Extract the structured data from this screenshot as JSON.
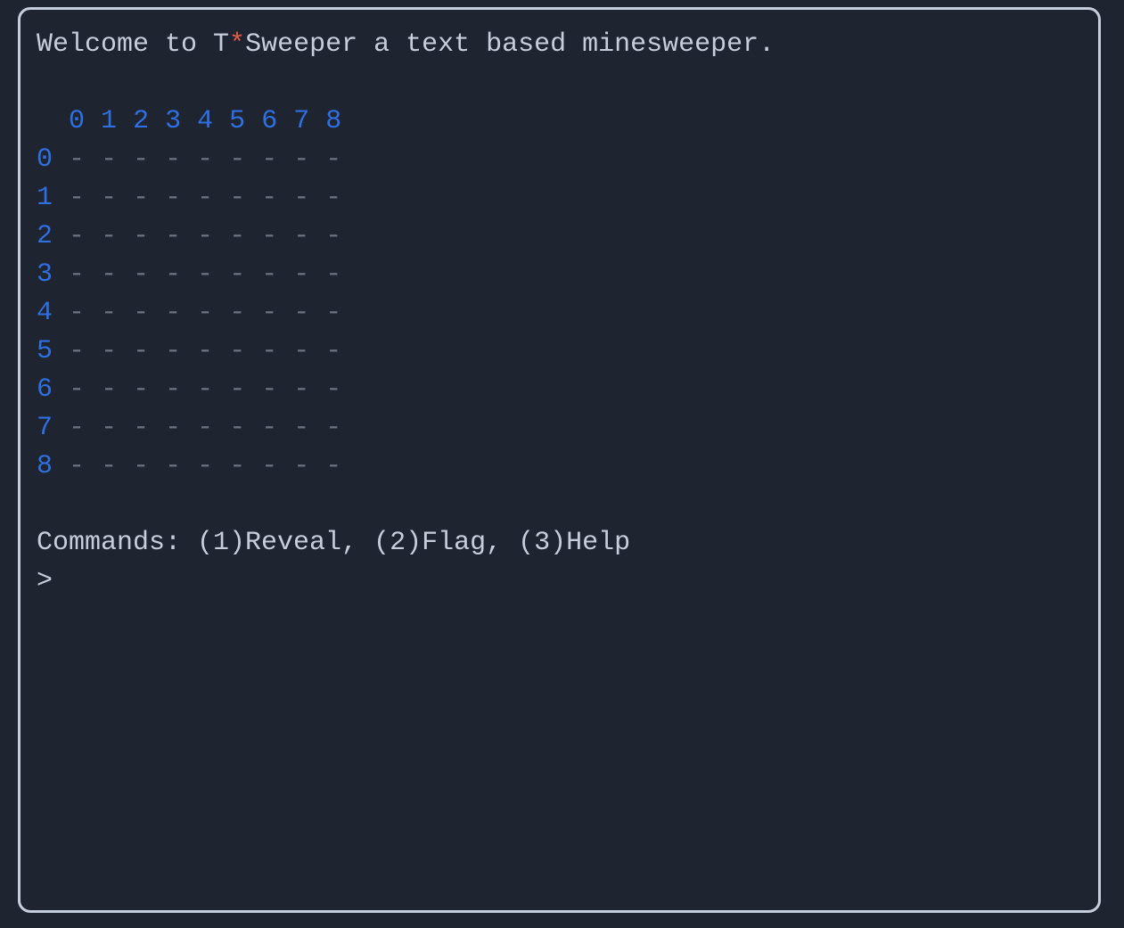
{
  "title_prefix": "Welcome to T",
  "title_star": "*",
  "title_suffix": "Sweeper a text based minesweeper.",
  "col_headers": [
    "0",
    "1",
    "2",
    "3",
    "4",
    "5",
    "6",
    "7",
    "8"
  ],
  "rows": [
    {
      "label": "0",
      "cells": [
        "-",
        "-",
        "-",
        "-",
        "-",
        "-",
        "-",
        "-",
        "-"
      ]
    },
    {
      "label": "1",
      "cells": [
        "-",
        "-",
        "-",
        "-",
        "-",
        "-",
        "-",
        "-",
        "-"
      ]
    },
    {
      "label": "2",
      "cells": [
        "-",
        "-",
        "-",
        "-",
        "-",
        "-",
        "-",
        "-",
        "-"
      ]
    },
    {
      "label": "3",
      "cells": [
        "-",
        "-",
        "-",
        "-",
        "-",
        "-",
        "-",
        "-",
        "-"
      ]
    },
    {
      "label": "4",
      "cells": [
        "-",
        "-",
        "-",
        "-",
        "-",
        "-",
        "-",
        "-",
        "-"
      ]
    },
    {
      "label": "5",
      "cells": [
        "-",
        "-",
        "-",
        "-",
        "-",
        "-",
        "-",
        "-",
        "-"
      ]
    },
    {
      "label": "6",
      "cells": [
        "-",
        "-",
        "-",
        "-",
        "-",
        "-",
        "-",
        "-",
        "-"
      ]
    },
    {
      "label": "7",
      "cells": [
        "-",
        "-",
        "-",
        "-",
        "-",
        "-",
        "-",
        "-",
        "-"
      ]
    },
    {
      "label": "8",
      "cells": [
        "-",
        "-",
        "-",
        "-",
        "-",
        "-",
        "-",
        "-",
        "-"
      ]
    }
  ],
  "commands_line": "Commands: (1)Reveal, (2)Flag, (3)Help",
  "prompt": ">"
}
